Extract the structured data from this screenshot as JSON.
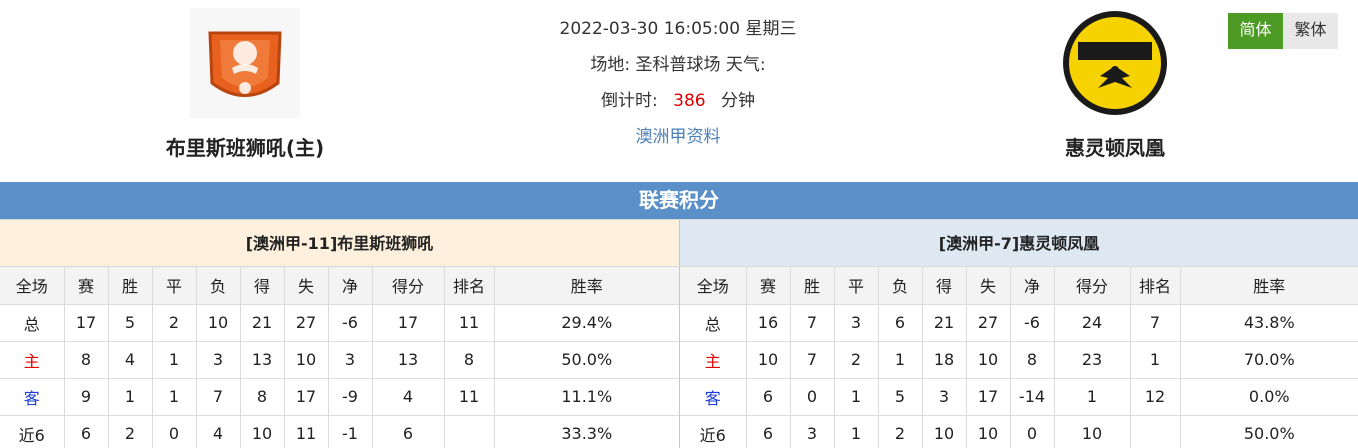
{
  "match": {
    "datetime": "2022-03-30 16:05:00",
    "weekday": "星期三",
    "venue_label": "场地:",
    "venue": "圣科普球场",
    "weather_label": "天气:",
    "countdown_label": "倒计时:",
    "countdown_value": "386",
    "countdown_unit": "分钟",
    "league_link": "澳洲甲资料"
  },
  "home_team": {
    "name": "布里斯班狮吼(主)",
    "logo_icon": "brisbane-roar-crest"
  },
  "away_team": {
    "name": "惠灵顿凤凰",
    "logo_icon": "wellington-phoenix-crest"
  },
  "lang": {
    "simplified": "简体",
    "traditional": "繁体"
  },
  "section_title": "联赛积分",
  "columns": [
    "全场",
    "赛",
    "胜",
    "平",
    "负",
    "得",
    "失",
    "净",
    "得分",
    "排名",
    "胜率"
  ],
  "home_table": {
    "title": "[澳洲甲-11]布里斯班狮吼",
    "rows": [
      [
        "总",
        "17",
        "5",
        "2",
        "10",
        "21",
        "27",
        "-6",
        "17",
        "11",
        "29.4%"
      ],
      [
        "主",
        "8",
        "4",
        "1",
        "3",
        "13",
        "10",
        "3",
        "13",
        "8",
        "50.0%"
      ],
      [
        "客",
        "9",
        "1",
        "1",
        "7",
        "8",
        "17",
        "-9",
        "4",
        "11",
        "11.1%"
      ],
      [
        "近6",
        "6",
        "2",
        "0",
        "4",
        "10",
        "11",
        "-1",
        "6",
        "",
        "33.3%"
      ]
    ]
  },
  "away_table": {
    "title": "[澳洲甲-7]惠灵顿凤凰",
    "rows": [
      [
        "总",
        "16",
        "7",
        "3",
        "6",
        "21",
        "27",
        "-6",
        "24",
        "7",
        "43.8%"
      ],
      [
        "主",
        "10",
        "7",
        "2",
        "1",
        "18",
        "10",
        "8",
        "23",
        "1",
        "70.0%"
      ],
      [
        "客",
        "6",
        "0",
        "1",
        "5",
        "3",
        "17",
        "-14",
        "1",
        "12",
        "0.0%"
      ],
      [
        "近6",
        "6",
        "3",
        "1",
        "2",
        "10",
        "10",
        "0",
        "10",
        "",
        "50.0%"
      ]
    ]
  },
  "colors": {
    "banner": "#5b8fc7",
    "home_label": "#e00000",
    "away_label": "#1a3fd6",
    "lang_active": "#4d9b25"
  }
}
